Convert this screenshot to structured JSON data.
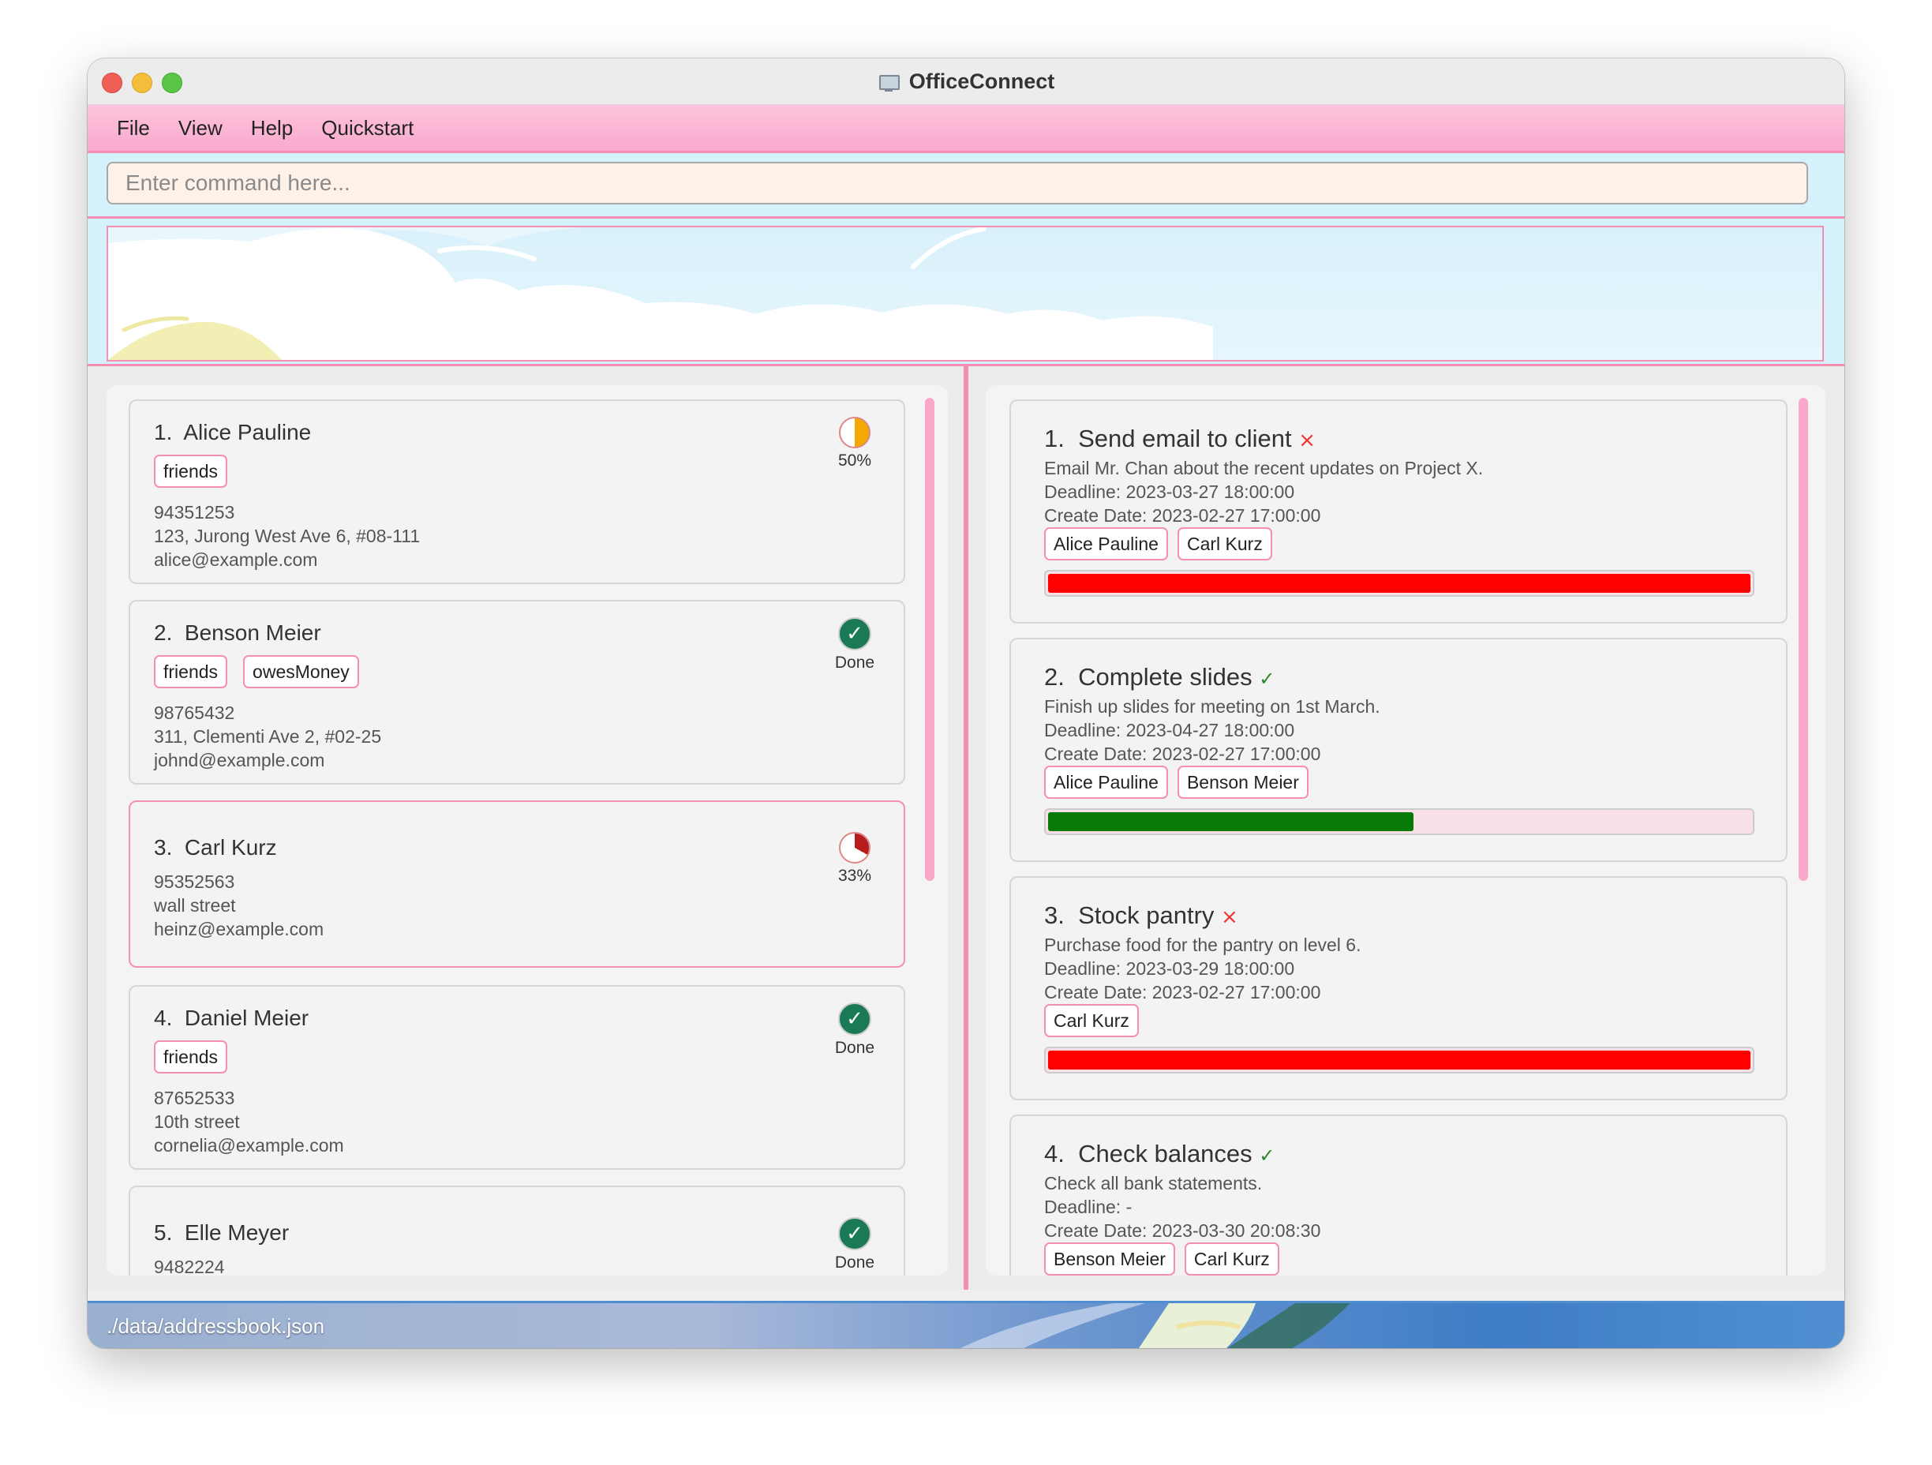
{
  "window": {
    "title": "OfficeConnect"
  },
  "menu": {
    "items": [
      "File",
      "View",
      "Help",
      "Quickstart"
    ]
  },
  "command": {
    "placeholder": "Enter command here..."
  },
  "persons": [
    {
      "index": "1.",
      "name": "Alice Pauline",
      "tags": [
        "friends"
      ],
      "phone": "94351253",
      "address": "123, Jurong West Ave 6, #08-111",
      "email": "alice@example.com",
      "status_label": "50%",
      "progress": 0.5
    },
    {
      "index": "2.",
      "name": "Benson Meier",
      "tags": [
        "friends",
        "owesMoney"
      ],
      "phone": "98765432",
      "address": "311, Clementi Ave 2, #02-25",
      "email": "johnd@example.com",
      "status_label": "Done",
      "progress": 1.0
    },
    {
      "index": "3.",
      "name": "Carl Kurz",
      "tags": [],
      "phone": "95352563",
      "address": "wall street",
      "email": "heinz@example.com",
      "status_label": "33%",
      "progress": 0.33
    },
    {
      "index": "4.",
      "name": "Daniel Meier",
      "tags": [
        "friends"
      ],
      "phone": "87652533",
      "address": "10th street",
      "email": "cornelia@example.com",
      "status_label": "Done",
      "progress": 1.0
    },
    {
      "index": "5.",
      "name": "Elle Meyer",
      "tags": [],
      "phone": "9482224",
      "address": "",
      "email": "",
      "status_label": "Done",
      "progress": 1.0
    }
  ],
  "tasks": [
    {
      "index": "1.",
      "title": "Send email to client",
      "done": false,
      "description": "Email Mr. Chan about the recent updates on Project X.",
      "deadline": "Deadline: 2023-03-27 18:00:00",
      "created": "Create Date: 2023-02-27 17:00:00",
      "assignees": [
        "Alice Pauline",
        "Carl Kurz"
      ],
      "progress": 1.0,
      "bar_color": "#ff0000"
    },
    {
      "index": "2.",
      "title": "Complete slides",
      "done": true,
      "description": "Finish up slides for meeting on 1st March.",
      "deadline": "Deadline: 2023-04-27 18:00:00",
      "created": "Create Date: 2023-02-27 17:00:00",
      "assignees": [
        "Alice Pauline",
        "Benson Meier"
      ],
      "progress": 0.52,
      "bar_color": "#087a08"
    },
    {
      "index": "3.",
      "title": "Stock pantry",
      "done": false,
      "description": "Purchase food for the pantry on level 6.",
      "deadline": "Deadline: 2023-03-29 18:00:00",
      "created": "Create Date: 2023-02-27 17:00:00",
      "assignees": [
        "Carl Kurz"
      ],
      "progress": 1.0,
      "bar_color": "#ff0000"
    },
    {
      "index": "4.",
      "title": "Check balances",
      "done": true,
      "description": "Check all bank statements.",
      "deadline": "Deadline: -",
      "created": "Create Date: 2023-03-30 20:08:30",
      "assignees": [
        "Benson Meier",
        "Carl Kurz"
      ],
      "progress": null,
      "bar_color": ""
    }
  ],
  "marks": {
    "done": "✓",
    "not_done": "×"
  },
  "statusbar": {
    "path": "./data/addressbook.json"
  },
  "colors": {
    "accent_pink": "#f48fb1",
    "menubar_pink": "#fbb6d5",
    "command_bg": "#d5f1fb",
    "done_green": "#1b7a56",
    "pie_orange": "#f5a800",
    "pie_red": "#b71c1c"
  }
}
